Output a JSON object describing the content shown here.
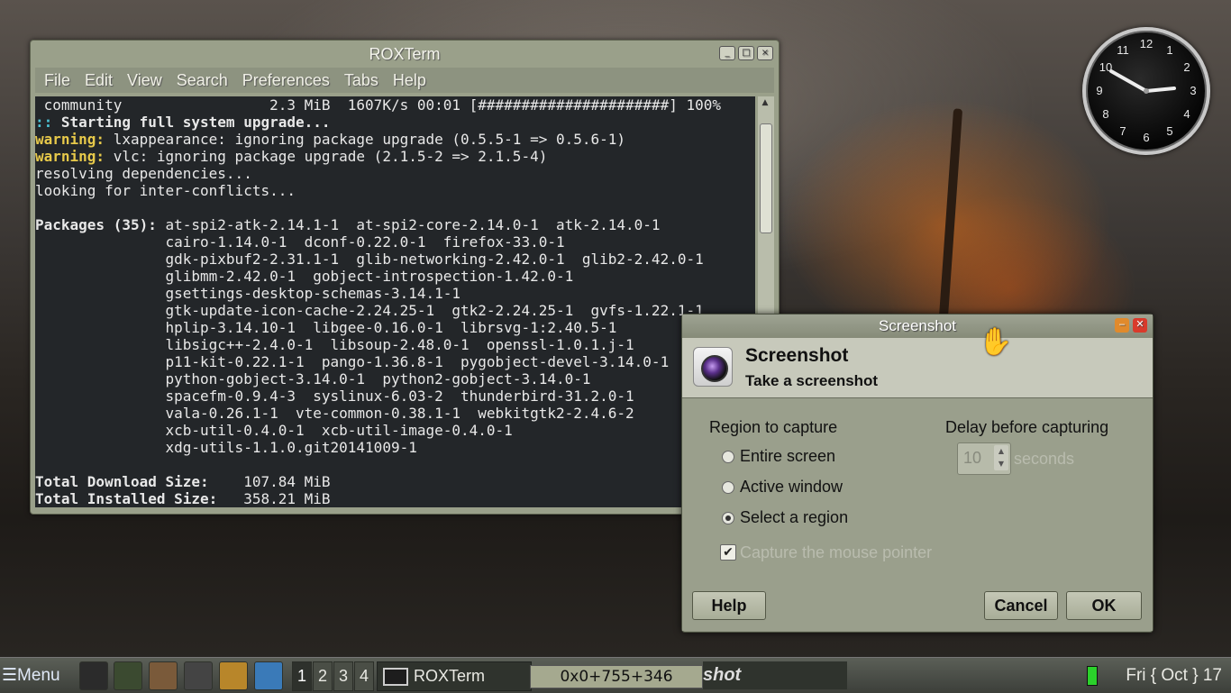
{
  "terminal": {
    "title": "ROXTerm",
    "menu": [
      "File",
      "Edit",
      "View",
      "Search",
      "Preferences",
      "Tabs",
      "Help"
    ],
    "lines": [
      {
        "prefix": "",
        "text": " community                 2.3 MiB  1607K/s 00:01 [######################] 100%",
        "style": ""
      },
      {
        "prefix": "::",
        "text": " Starting full system upgrade...",
        "style": "bold"
      },
      {
        "prefix": "warning:",
        "text": " lxappearance: ignoring package upgrade (0.5.5-1 => 0.5.6-1)",
        "style": "warn"
      },
      {
        "prefix": "warning:",
        "text": " vlc: ignoring package upgrade (2.1.5-2 => 2.1.5-4)",
        "style": "warn"
      },
      {
        "prefix": "",
        "text": "resolving dependencies...",
        "style": ""
      },
      {
        "prefix": "",
        "text": "looking for inter-conflicts...",
        "style": ""
      },
      {
        "prefix": "",
        "text": "",
        "style": ""
      },
      {
        "prefix": "Packages (35):",
        "text": " at-spi2-atk-2.14.1-1  at-spi2-core-2.14.0-1  atk-2.14.0-1",
        "style": "boldprefix"
      },
      {
        "prefix": "",
        "text": "               cairo-1.14.0-1  dconf-0.22.0-1  firefox-33.0-1",
        "style": ""
      },
      {
        "prefix": "",
        "text": "               gdk-pixbuf2-2.31.1-1  glib-networking-2.42.0-1  glib2-2.42.0-1",
        "style": ""
      },
      {
        "prefix": "",
        "text": "               glibmm-2.42.0-1  gobject-introspection-1.42.0-1",
        "style": ""
      },
      {
        "prefix": "",
        "text": "               gsettings-desktop-schemas-3.14.1-1",
        "style": ""
      },
      {
        "prefix": "",
        "text": "               gtk-update-icon-cache-2.24.25-1  gtk2-2.24.25-1  gvfs-1.22.1-1",
        "style": ""
      },
      {
        "prefix": "",
        "text": "               hplip-3.14.10-1  libgee-0.16.0-1  librsvg-1:2.40.5-1",
        "style": ""
      },
      {
        "prefix": "",
        "text": "               libsigc++-2.4.0-1  libsoup-2.48.0-1  openssl-1.0.1.j-1",
        "style": ""
      },
      {
        "prefix": "",
        "text": "               p11-kit-0.22.1-1  pango-1.36.8-1  pygobject-devel-3.14.0-1",
        "style": ""
      },
      {
        "prefix": "",
        "text": "               python-gobject-3.14.0-1  python2-gobject-3.14.0-1",
        "style": ""
      },
      {
        "prefix": "",
        "text": "               spacefm-0.9.4-3  syslinux-6.03-2  thunderbird-31.2.0-1",
        "style": ""
      },
      {
        "prefix": "",
        "text": "               vala-0.26.1-1  vte-common-0.38.1-1  webkitgtk2-2.4.6-2",
        "style": ""
      },
      {
        "prefix": "",
        "text": "               xcb-util-0.4.0-1  xcb-util-image-0.4.0-1",
        "style": ""
      },
      {
        "prefix": "",
        "text": "               xdg-utils-1.1.0.git20141009-1",
        "style": ""
      },
      {
        "prefix": "",
        "text": "",
        "style": ""
      },
      {
        "prefix": "Total Download Size:",
        "text": "    107.84 MiB",
        "style": "boldprefix"
      },
      {
        "prefix": "Total Installed Size:",
        "text": "   358.21 MiB",
        "style": "boldprefix"
      }
    ]
  },
  "clock": {
    "numbers": [
      "12",
      "1",
      "2",
      "3",
      "4",
      "5",
      "6",
      "7",
      "8",
      "9",
      "10",
      "11"
    ]
  },
  "dialog": {
    "window_title": "Screenshot",
    "heading": "Screenshot",
    "subheading": "Take a screenshot",
    "region_label": "Region to capture",
    "options": [
      "Entire screen",
      "Active window",
      "Select a region"
    ],
    "selected_option": "Select a region",
    "capture_pointer_label": "Capture the mouse pointer",
    "delay_label": "Delay before capturing",
    "delay_value": "10",
    "delay_unit": "seconds",
    "help_label": "Help",
    "cancel_label": "Cancel",
    "ok_label": "OK"
  },
  "taskbar": {
    "menu_label": "Menu",
    "desktops": [
      "1",
      "2",
      "3",
      "4"
    ],
    "active_window": "ROXTerm",
    "coords": "0x0+755+346",
    "shot_label": "shot",
    "datetime": "Fri { Oct } 17"
  },
  "colors": {
    "warning": "#e7c94a",
    "terminal_bg": "#232629",
    "theme": "#9aa08a",
    "battery": "#2bd12b"
  }
}
